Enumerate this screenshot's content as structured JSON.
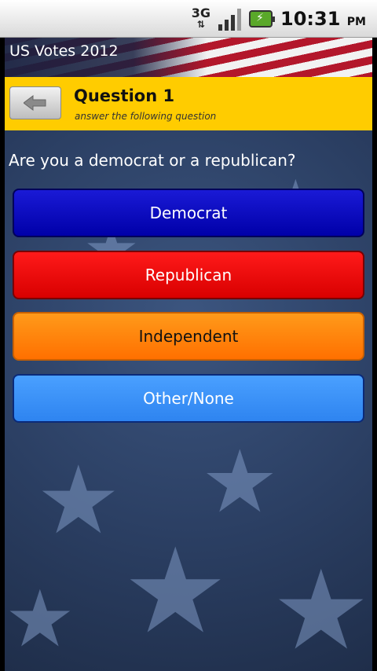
{
  "statusbar": {
    "network": "3G",
    "time": "10:31",
    "ampm": "PM"
  },
  "app": {
    "title": "US Votes 2012"
  },
  "header": {
    "title": "Question 1",
    "subtitle": "answer the following question"
  },
  "question": "Are you a democrat or a republican?",
  "answers": [
    {
      "label": "Democrat",
      "color": "#0000c8"
    },
    {
      "label": "Republican",
      "color": "#ee0000"
    },
    {
      "label": "Independent",
      "color": "#ff8800"
    },
    {
      "label": "Other/None",
      "color": "#3890f8"
    }
  ],
  "colors": {
    "header_bg": "#ffcc00",
    "background": "#2b3f63"
  }
}
